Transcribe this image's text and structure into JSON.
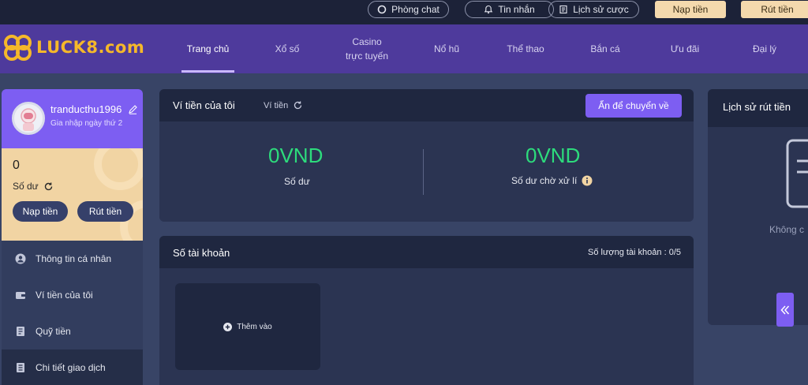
{
  "topbar": {
    "chat_label": "Phòng chat",
    "messages_label": "Tin nhắn",
    "bet_history_label": "Lịch sử cược",
    "deposit_label": "Nạp tiền",
    "withdraw_label": "Rút tiền"
  },
  "logo": {
    "text": "LUCK8.com"
  },
  "nav": {
    "items": [
      {
        "label": "Trang chủ"
      },
      {
        "label": "Xổ số"
      },
      {
        "label": "Casino",
        "label2": "trực tuyến"
      },
      {
        "label": "Nổ hũ"
      },
      {
        "label": "Thể thao"
      },
      {
        "label": "Bắn cá"
      },
      {
        "label": "Ưu đãi"
      },
      {
        "label": "Đại lý"
      }
    ],
    "active_index": 0
  },
  "profile": {
    "username": "tranducthu1996",
    "joined": "Gia nhập ngày thứ 2"
  },
  "balance": {
    "amount": "0",
    "label": "Số dư",
    "deposit_label": "Nạp tiền",
    "withdraw_label": "Rút tiền"
  },
  "menu": {
    "items": [
      {
        "label": "Thông tin cá nhân",
        "icon": "user-icon"
      },
      {
        "label": "Ví tiền của tôi",
        "icon": "wallet-icon"
      },
      {
        "label": "Quỹ tiền",
        "icon": "fund-icon"
      },
      {
        "label": "Chi tiết giao dịch",
        "icon": "transaction-icon"
      }
    ],
    "selected_index": 3
  },
  "wallet": {
    "title": "Ví tiền của tôi",
    "tab_label": "Ví tiền",
    "hide_button_label": "Ẩn để chuyển về",
    "balance_amount": "0VND",
    "balance_label": "Số dư",
    "pending_amount": "0VND",
    "pending_label": "Số dư chờ xử lí"
  },
  "accounts": {
    "title": "Số tài khoản",
    "count_label": "Số lượng tài khoản :",
    "count_value": "0/5",
    "add_label": "Thêm vào"
  },
  "withdraw_history": {
    "title": "Lịch sử rút tiền",
    "empty_text": "Không c"
  },
  "colors": {
    "accent": "#7d5ef2",
    "nav_bg": "#4e3a9c",
    "gold": "#f4d9ad",
    "amount_green": "#2ddc7c"
  }
}
